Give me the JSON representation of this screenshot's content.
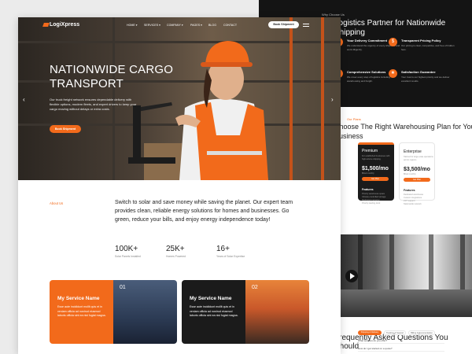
{
  "colors": {
    "accent": "#f26a1b",
    "dark": "#141414",
    "card_dark": "#1b1b1b"
  },
  "nav": {
    "logo": "LogiXpress",
    "links": [
      {
        "label": "HOME ▾"
      },
      {
        "label": "SERVICES ▾"
      },
      {
        "label": "COMPANY ▾"
      },
      {
        "label": "PAGES ▾"
      },
      {
        "label": "BLOG"
      },
      {
        "label": "CONTACT"
      }
    ],
    "cta": "Book Shipment",
    "menu_icon": "hamburger-icon"
  },
  "hero": {
    "title": "NATIONWIDE CARGO TRANSPORT",
    "description": "Our truck freight network ensures dependable delivery with flexible options, modern fleets, and expert drivers to keep your cargo moving without delays or extra costs.",
    "cta": "Book Shipment",
    "prev_icon": "chevron-left-icon",
    "next_icon": "chevron-right-icon"
  },
  "about": {
    "tag": "About Us",
    "text": "Switch to solar and save money while saving the planet. Our expert team provides clean, reliable energy solutions for homes and businesses. Go green, reduce your bills, and enjoy energy independence today!",
    "stats": [
      {
        "value": "100K+",
        "label": "Solar Panels Installed"
      },
      {
        "value": "25K+",
        "label": "Homes Powered"
      },
      {
        "value": "16+",
        "label": "Years of Solar Expertise"
      }
    ]
  },
  "services": [
    {
      "title": "My Service Name",
      "number": "01",
      "description": "Esse aute incididunt mollit quis et in veniam officia ad nostrud eiusmod laboris officia sint ea nisi fugiat magna."
    },
    {
      "title": "My Service Name",
      "number": "02",
      "description": "Esse aute incididunt mollit quis et in veniam officia ad nostrud eiusmod laboris officia sint ea nisi fugiat magna."
    }
  ],
  "why": {
    "eyebrow": "Why Choose Us",
    "title": "Logistics Partner for Nationwide Shipping",
    "features": [
      {
        "title": "Your Delivery Commitment",
        "description": "We understand the urgency of every shipment and work diligently.",
        "icon": "check-icon"
      },
      {
        "title": "Transparent Pricing Policy",
        "description": "Our pricing is clear, competitive, and free of hidden fees.",
        "icon": "tag-icon"
      },
      {
        "title": "Comprehensive Solutions",
        "description": "We cover every step of logistics including warehousing and freight.",
        "icon": "layers-icon"
      },
      {
        "title": "Satisfaction Guarantee",
        "description": "Your trust is our highest priority and we deliver excellent results.",
        "icon": "thumb-icon"
      }
    ]
  },
  "pricing": {
    "tag": "Our Plans",
    "title": "Choose The Right Warehousing Plan for Your Business",
    "plans": [
      {
        "name": "Premium",
        "desc": "For established businesses with high-volume shipping.",
        "price": "$1,500/mo",
        "unit": "Billed monthly",
        "cta": "Get Plan",
        "features_label": "Features",
        "features": [
          "Priority warehouse space",
          "Climate-controlled storage",
          "Dedicated manager",
          "Priority loading dock"
        ]
      },
      {
        "name": "Enterprise",
        "desc": "Tailored for large-scale operations across regions.",
        "price": "$3,500/mo",
        "unit": "Billed monthly",
        "cta": "Get Plan",
        "features_label": "Features",
        "features": [
          "Dedicated warehouse",
          "Custom integrations",
          "24/7 support",
          "Nationwide network"
        ]
      }
    ]
  },
  "video": {
    "play_icon": "play-icon"
  },
  "faq": {
    "title": "Frequently Asked Questions You Should",
    "tabs": [
      "Shipping & Delivery",
      "Tracking & Support",
      "Billing & Documentation"
    ],
    "questions": [
      "What services do you offer?",
      "How do I get started on a quote?"
    ]
  }
}
